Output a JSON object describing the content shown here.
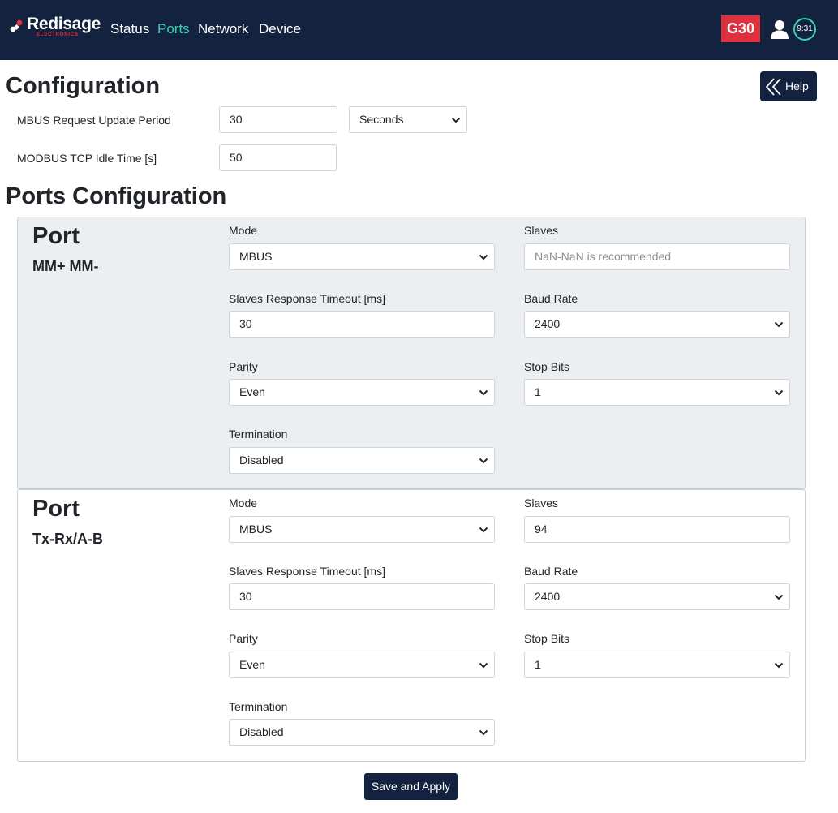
{
  "nav": {
    "brand": "Redisage",
    "brand_sub": "ELECTRONICS",
    "links": [
      "Status",
      "Ports",
      "Network",
      "Device"
    ],
    "active": "Ports",
    "device_badge": "G30",
    "clock": "9:31"
  },
  "config": {
    "title": "Configuration",
    "help_label": "Help",
    "mbus_period_label": "MBUS Request Update Period",
    "mbus_period_value": "30",
    "mbus_period_unit": "Seconds",
    "modbus_idle_label": "MODBUS TCP Idle Time [s]",
    "modbus_idle_value": "50"
  },
  "ports": {
    "title": "Ports Configuration",
    "items": [
      {
        "title": "Port",
        "subtitle": "MM+ MM-",
        "mode_label": "Mode",
        "mode": "MBUS",
        "slaves_label": "Slaves",
        "slaves": "",
        "slaves_placeholder": "NaN-NaN is recommended",
        "timeout_label": "Slaves Response Timeout [ms]",
        "timeout": "30",
        "baud_label": "Baud Rate",
        "baud": "2400",
        "parity_label": "Parity",
        "parity": "Even",
        "stop_label": "Stop Bits",
        "stop": "1",
        "termination_label": "Termination",
        "termination": "Disabled"
      },
      {
        "title": "Port",
        "subtitle": "Tx-Rx/A-B",
        "mode_label": "Mode",
        "mode": "MBUS",
        "slaves_label": "Slaves",
        "slaves": "94",
        "slaves_placeholder": "",
        "timeout_label": "Slaves Response Timeout [ms]",
        "timeout": "30",
        "baud_label": "Baud Rate",
        "baud": "2400",
        "parity_label": "Parity",
        "parity": "Even",
        "stop_label": "Stop Bits",
        "stop": "1",
        "termination_label": "Termination",
        "termination": "Disabled"
      }
    ]
  },
  "save_label": "Save and Apply",
  "colors": {
    "navbar": "#13233f",
    "accent": "#34d2b0",
    "brand_red": "#e0303e",
    "card_shade": "#eceff1"
  }
}
